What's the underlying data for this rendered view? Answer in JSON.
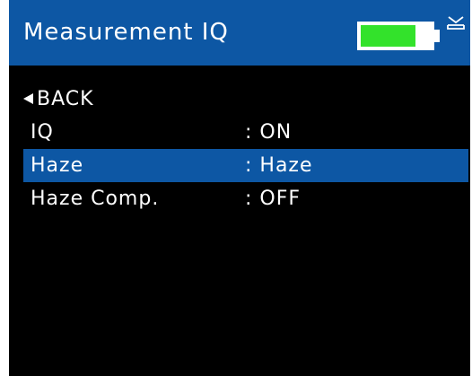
{
  "header": {
    "title": "Measurement IQ",
    "battery_level": 0.78,
    "battery_color": "#33e22b",
    "status_icon": "sd-card-icon"
  },
  "colors": {
    "header_bg": "#0d57a4",
    "screen_bg": "#000000",
    "selection_bg": "#0d57a4",
    "text": "#ffffff"
  },
  "menu": {
    "back_label": "BACK",
    "items": [
      {
        "label": "IQ",
        "value": ": ON",
        "selected": false
      },
      {
        "label": "Haze",
        "value": ": Haze",
        "selected": true
      },
      {
        "label": "Haze Comp.",
        "value": ": OFF",
        "selected": false
      }
    ]
  }
}
